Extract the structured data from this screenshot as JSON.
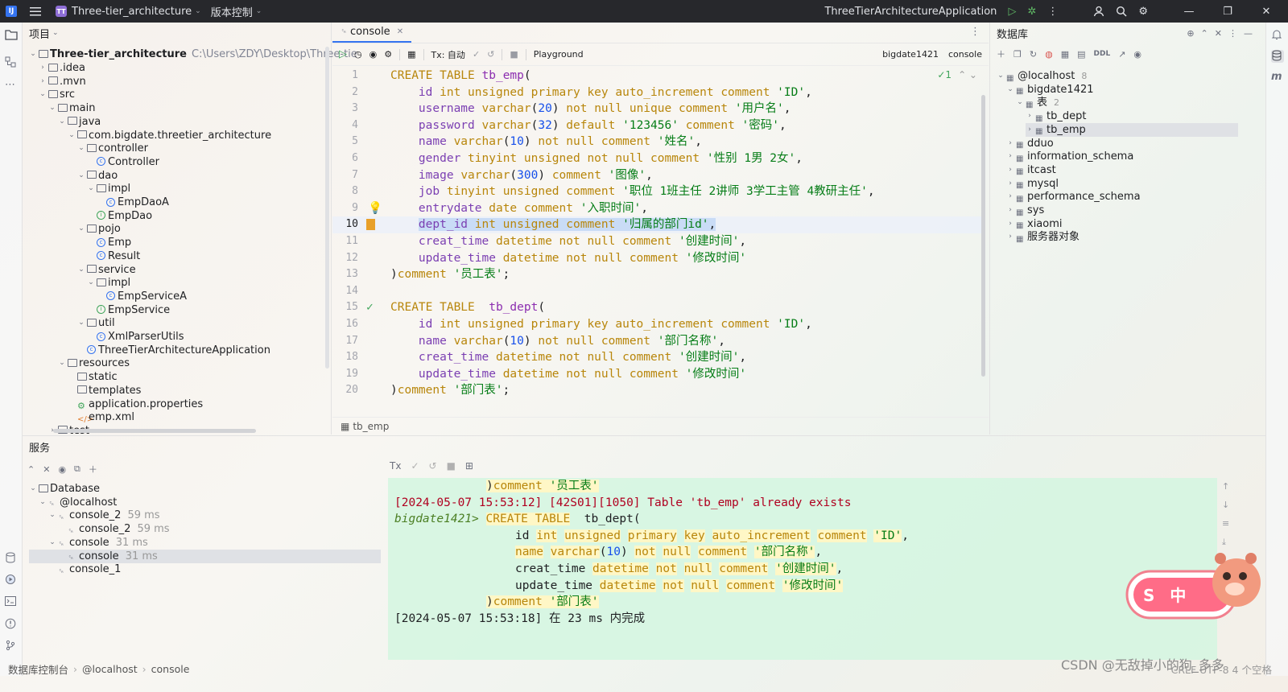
{
  "titlebar": {
    "project_badge": "TT",
    "project_name": "Three-tier_architecture",
    "vcs": "版本控制",
    "run_config": "ThreeTierArchitectureApplication"
  },
  "project": {
    "header": "项目",
    "root_name": "Three-tier_architecture",
    "root_path": "C:\\Users\\ZDY\\Desktop\\Three-tie",
    "rows": [
      {
        "label": ".idea",
        "icon": "folder"
      },
      {
        "label": ".mvn",
        "icon": "folder"
      },
      {
        "label": "src",
        "icon": "folder"
      },
      {
        "label": "main",
        "icon": "folder"
      },
      {
        "label": "java",
        "icon": "folder"
      },
      {
        "label": "com.bigdate.threetier_architecture",
        "icon": "package"
      },
      {
        "label": "controller",
        "icon": "package"
      },
      {
        "label": "Controller",
        "icon": "class"
      },
      {
        "label": "dao",
        "icon": "package"
      },
      {
        "label": "impl",
        "icon": "package"
      },
      {
        "label": "EmpDaoA",
        "icon": "class"
      },
      {
        "label": "EmpDao",
        "icon": "interface"
      },
      {
        "label": "pojo",
        "icon": "package"
      },
      {
        "label": "Emp",
        "icon": "class"
      },
      {
        "label": "Result",
        "icon": "class"
      },
      {
        "label": "service",
        "icon": "package"
      },
      {
        "label": "impl",
        "icon": "package"
      },
      {
        "label": "EmpServiceA",
        "icon": "class"
      },
      {
        "label": "EmpService",
        "icon": "interface"
      },
      {
        "label": "util",
        "icon": "package"
      },
      {
        "label": "XmlParserUtils",
        "icon": "class"
      },
      {
        "label": "ThreeTierArchitectureApplication",
        "icon": "class"
      },
      {
        "label": "resources",
        "icon": "folder"
      },
      {
        "label": "static",
        "icon": "folder"
      },
      {
        "label": "templates",
        "icon": "folder"
      },
      {
        "label": "application.properties",
        "icon": "properties"
      },
      {
        "label": "emp.xml",
        "icon": "xml"
      },
      {
        "label": "test",
        "icon": "folder"
      }
    ]
  },
  "editor": {
    "tab": "console",
    "tx_label": "Tx: 自动",
    "playground": "Playground",
    "datasource": "bigdate1421",
    "session": "console",
    "inspection_count": "1",
    "lines": [
      "1",
      "2",
      "3",
      "4",
      "5",
      "6",
      "7",
      "8",
      "9",
      "10",
      "11",
      "12",
      "13",
      "14",
      "15",
      "16",
      "17",
      "18",
      "19",
      "20"
    ],
    "breadcrumb": "tb_emp"
  },
  "database": {
    "header": "数据库",
    "host": "@localhost",
    "host_count": "8",
    "schema": "bigdate1421",
    "tables_folder": "表",
    "tables_count": "2",
    "tables": [
      "tb_dept",
      "tb_emp"
    ],
    "other_schemas": [
      "dduo",
      "information_schema",
      "itcast",
      "mysql",
      "performance_schema",
      "sys",
      "xiaomi"
    ],
    "server_objects": "服务器对象"
  },
  "services": {
    "header": "服务",
    "rows": [
      {
        "label": "Database",
        "extra": ""
      },
      {
        "label": "@localhost",
        "extra": ""
      },
      {
        "label": "console_2",
        "extra": "59 ms"
      },
      {
        "label": "console_2",
        "extra": "59 ms"
      },
      {
        "label": "console",
        "extra": "31 ms"
      },
      {
        "label": "console",
        "extra": "31 ms"
      },
      {
        "label": "console_1",
        "extra": ""
      }
    ],
    "out_tx": "Tx"
  },
  "output": {
    "line1_kw": "comment",
    "line1_str": "'员工表'",
    "error": "[2024-05-07 15:53:12] [42S01][1050] Table 'tb_emp' already exists",
    "prompt": "bigdate1421>",
    "done": "[2024-05-07 15:53:18] 在 23 ms 内完成"
  },
  "statusbar": {
    "crumb1": "数据库控制台",
    "crumb2": "@localhost",
    "crumb3": "console",
    "right": "CRLF  UTF-8  4 个空格"
  },
  "watermark": "CSDN @无敌掉小的狗_多多",
  "sticker_text": "S 中"
}
